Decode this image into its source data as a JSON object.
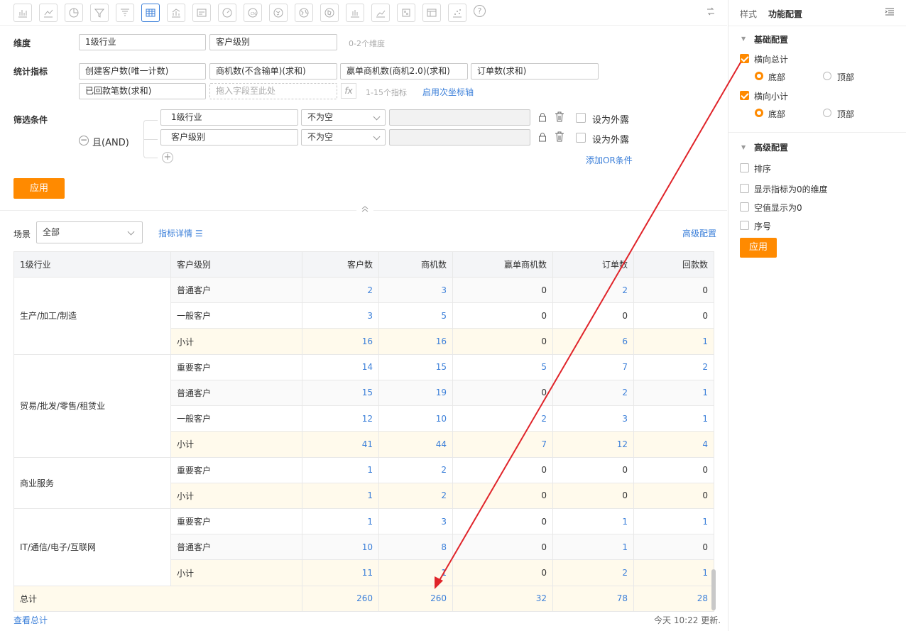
{
  "toolbar": {
    "icons": [
      "bar-chart",
      "line-chart",
      "pie-chart",
      "funnel",
      "funnel-2",
      "table",
      "combo-chart",
      "text-card",
      "gauge",
      "map-cn",
      "map-world",
      "globe",
      "map-region",
      "bar-small",
      "line-small",
      "heatmap",
      "pivot",
      "scatter",
      "help"
    ]
  },
  "dims": {
    "label": "维度",
    "items": [
      "1级行业",
      "客户级别"
    ],
    "hint": "0-2个维度"
  },
  "metrics": {
    "label": "统计指标",
    "items": [
      "创建客户数(唯一计数)",
      "商机数(不含输单)(求和)",
      "赢单商机数(商机2.0)(求和)",
      "订单数(求和)",
      "已回款笔数(求和)"
    ],
    "placeholder": "拖入字段至此处",
    "fx": "fx",
    "hint": "1-15个指标",
    "axis_link": "启用次坐标轴"
  },
  "filter": {
    "label": "筛选条件",
    "logic": "且(AND)",
    "rows": [
      {
        "field": "1级行业",
        "op": "不为空",
        "expose": "设为外露"
      },
      {
        "field": "客户级别",
        "op": "不为空",
        "expose": "设为外露"
      }
    ],
    "add_or": "添加OR条件"
  },
  "apply": "应用",
  "scene": {
    "label": "场景",
    "value": "全部",
    "detail": "指标详情",
    "advanced": "高级配置"
  },
  "table": {
    "headers": [
      "1级行业",
      "客户级别",
      "客户数",
      "商机数",
      "赢单商机数",
      "订单数",
      "回款数"
    ],
    "total": {
      "label": "总计",
      "values": [
        "260",
        "260",
        "32",
        "78",
        "28"
      ]
    }
  },
  "footer": {
    "view_total": "查看总计",
    "updated": "今天 10:22 更新."
  },
  "panel": {
    "tabs": [
      "样式",
      "功能配置"
    ],
    "basic": "基础配置",
    "h_total": "横向总计",
    "h_sub": "横向小计",
    "bottom": "底部",
    "top": "顶部",
    "advanced": "高级配置",
    "opts": [
      "排序",
      "显示指标为0的维度",
      "空值显示为0",
      "序号"
    ],
    "apply": "应用"
  },
  "colors": {
    "accent": "#ff8a00",
    "link": "#3b7fd9",
    "arrow": "#e0242a"
  }
}
